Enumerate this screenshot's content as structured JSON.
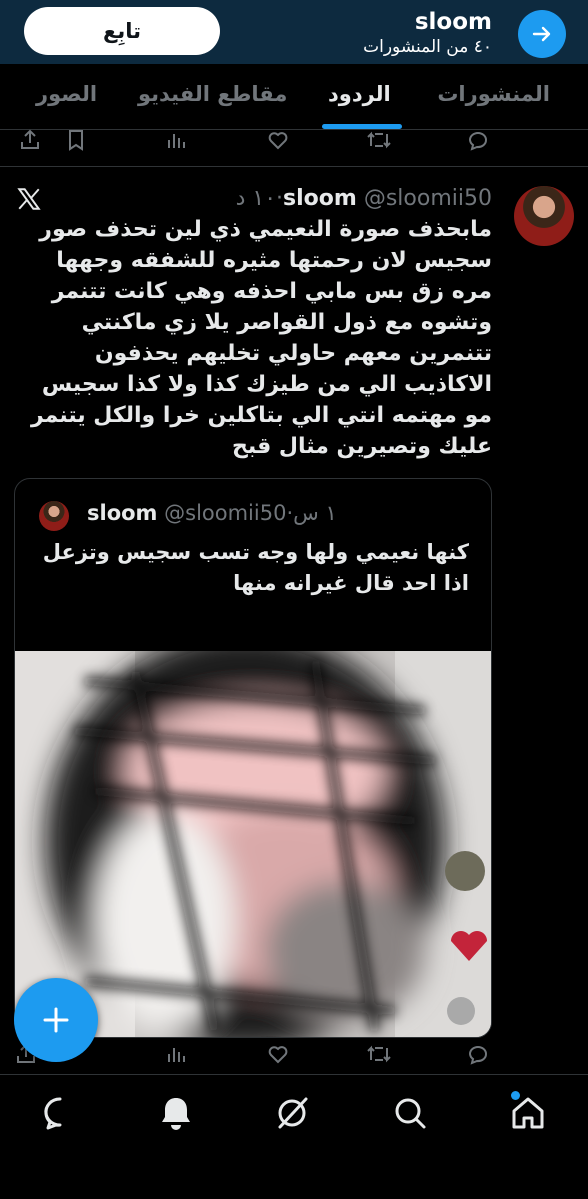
{
  "header": {
    "name": "sloom",
    "subtitle": "٤٠ من المنشورات",
    "follow_label": "تابِع"
  },
  "tabs": [
    {
      "label": "المنشورات",
      "active": false
    },
    {
      "label": "الردود",
      "active": true
    },
    {
      "label": "مقاطع الفيديو",
      "active": false
    },
    {
      "label": "الصور",
      "active": false
    }
  ],
  "tweet": {
    "name": "sloom",
    "handle": "@sloomii50",
    "time": "١٠ د",
    "text": "مابحذف صورة النعيمي ذي لين تحذف صور سجيس لان رحمتها مثيره للشفقه وجهها مره زق بس مابي احذفه وهي كانت تتنمر وتشوه مع ذول القواصر يلا زي ماكنتي تتنمرين معهم حاولي تخليهم يحذفون الاكاذيب الي من طيزك كذا ولا كذا سجيس مو مهتمه انتي الي بتاكلين خرا والكل يتنمر عليك وتصيرين مثال قبح",
    "quote": {
      "name": "sloom",
      "handle": "@sloomii50",
      "time": "١ س",
      "text": "كنها نعيمي ولها وجه تسب سجيس وتزعل اذا احد قال غيرانه منها"
    }
  },
  "colors": {
    "accent": "#1d9bf0",
    "header_bg": "#0d2a3f",
    "background": "#000000",
    "muted": "#71767b",
    "border": "#2f3336"
  },
  "icons": {
    "header": [
      "arrow-right-icon"
    ],
    "tweet_actions": [
      "share-icon",
      "bookmark-icon",
      "views-icon",
      "like-icon",
      "retweet-icon",
      "reply-icon"
    ],
    "bottom_nav": [
      "messages-icon",
      "notifications-icon",
      "grok-icon",
      "search-icon",
      "home-icon"
    ],
    "fab": "plus-icon"
  }
}
